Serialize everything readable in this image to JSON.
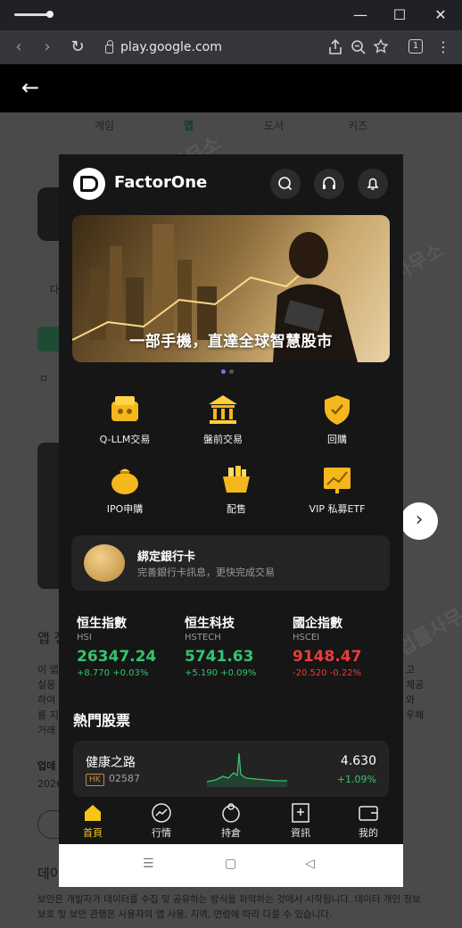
{
  "browser": {
    "url": "play.google.com",
    "tab_count": "1",
    "minimize": "—",
    "maximize": "☐",
    "close": "✕"
  },
  "page_behind": {
    "tabs": [
      "게임",
      "앱",
      "도서",
      "키즈"
    ],
    "fragments": {
      "left_1": "다",
      "left_2": "ㅁ",
      "about_heading": "앱 정",
      "desc": [
        "이 앱",
        "실용",
        "하여",
        "를 지",
        "거래"
      ],
      "desc_right": [
        "고",
        "제공",
        "와",
        "우해"
      ],
      "update_label": "업데",
      "update_date": "2026",
      "data_heading": "데이",
      "bottom_para": "보안은 개발자가 데이터를 수집 및 공유하는 방식을 파악하는 것에서 시작됩니다. 데이터 개인 정보 보호 및 보안 관행은 사용자의 앱 사용, 지역, 연령에 따라 다를 수 있습니다."
    },
    "watermark": "법률사무소"
  },
  "app": {
    "brand": "FactorOne",
    "banner_text": "一部手機，直達全球智慧股市",
    "menu": [
      {
        "label": "Q-LLM交易",
        "icon": "robot-icon"
      },
      {
        "label": "盤前交易",
        "icon": "bank-building-icon"
      },
      {
        "label": "回購",
        "icon": "shield-icon"
      },
      {
        "label": "IPO申購",
        "icon": "money-bag-icon"
      },
      {
        "label": "配售",
        "icon": "basket-icon"
      },
      {
        "label": "VIP 私募ETF",
        "icon": "chart-board-icon"
      }
    ],
    "bank": {
      "title": "綁定銀行卡",
      "subtitle": "完善銀行卡訊息，更快完成交易"
    },
    "indices": [
      {
        "name": "恒生指數",
        "code": "HSI",
        "value": "26347.24",
        "change": "+8.770",
        "pct": "+0.03%",
        "dir": "up"
      },
      {
        "name": "恒生科技",
        "code": "HSTECH",
        "value": "5741.63",
        "change": "+5.190",
        "pct": "+0.09%",
        "dir": "up"
      },
      {
        "name": "國企指數",
        "code": "HSCEI",
        "value": "9148.47",
        "change": "-20.520",
        "pct": "-0.22%",
        "dir": "down"
      }
    ],
    "hot_title": "熱門股票",
    "stock": {
      "name": "健康之路",
      "market": "HK",
      "code": "02587",
      "price": "4.630",
      "change": "+1.09%"
    },
    "tabs": [
      {
        "label": "首頁",
        "icon": "home-icon"
      },
      {
        "label": "行情",
        "icon": "market-icon"
      },
      {
        "label": "持倉",
        "icon": "position-icon"
      },
      {
        "label": "資訊",
        "icon": "news-icon"
      },
      {
        "label": "我的",
        "icon": "wallet-icon"
      }
    ]
  },
  "colors": {
    "up": "#34c471",
    "down": "#f03a3a",
    "accent_gold": "#f5c518"
  }
}
